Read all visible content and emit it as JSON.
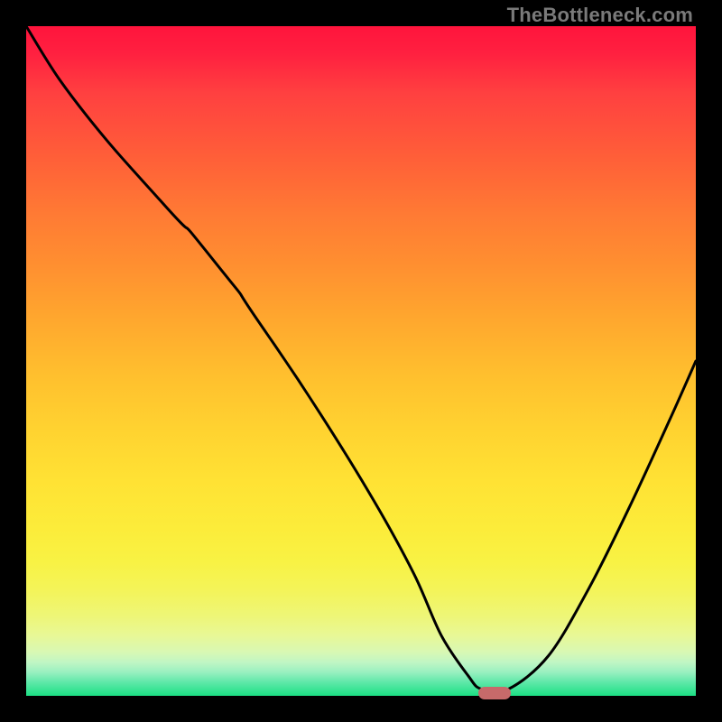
{
  "watermark": "TheBottleneck.com",
  "colors": {
    "curve_stroke": "#000000",
    "marker_fill": "#c76a6a"
  },
  "chart_data": {
    "type": "line",
    "title": "",
    "xlabel": "",
    "ylabel": "",
    "xlim": [
      0,
      100
    ],
    "ylim": [
      0,
      100
    ],
    "x": [
      0,
      5,
      12,
      20,
      28,
      36,
      44,
      52,
      58,
      62,
      66,
      68,
      72,
      78,
      84,
      90,
      96,
      100
    ],
    "values": [
      100,
      92,
      83,
      74,
      65,
      54,
      42,
      29,
      18,
      9,
      3,
      1,
      1,
      6,
      16,
      28,
      41,
      50
    ],
    "marker": {
      "x": 70,
      "y": 0
    },
    "kink_at_x": 28
  }
}
